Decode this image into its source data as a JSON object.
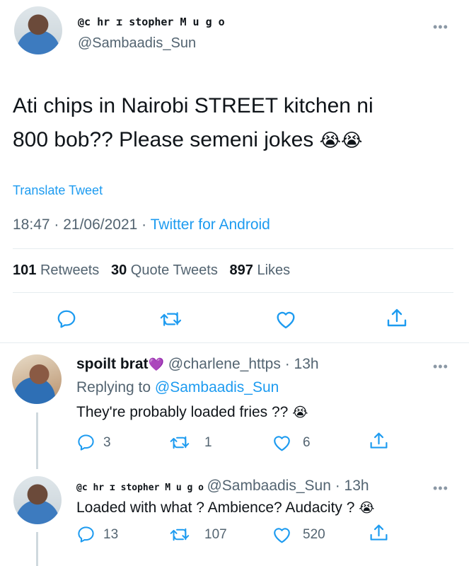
{
  "main_tweet": {
    "display_name": "@c hr ɪ stopher  M u g o",
    "handle": "@Sambaadis_Sun",
    "text_line1": "Ati chips in Nairobi STREET kitchen ni",
    "text_line2": "800 bob?? Please semeni jokes",
    "emoji": "😭😭",
    "translate": "Translate Tweet",
    "timestamp": "18:47 · 21/06/2021 · ",
    "source": "Twitter for Android",
    "retweets_count": "101",
    "retweets_label": "Retweets",
    "quotes_count": "30",
    "quotes_label": "Quote Tweets",
    "likes_count": "897",
    "likes_label": "Likes",
    "more": "•••"
  },
  "reply1": {
    "display_name": "spoilt brat",
    "emoji_heart": "💜",
    "handle_time": "@charlene_https · 13h",
    "replying_prefix": "Replying to ",
    "replying_to": "@Sambaadis_Sun",
    "text": "They're probably loaded fries ??",
    "emoji": "😭",
    "reply_count": "3",
    "retweet_count": "1",
    "like_count": "6",
    "more": "•••"
  },
  "reply2": {
    "display_name": "@c hr ɪ stopher  M u g o",
    "handle_time": "@Sambaadis_Sun · 13h",
    "text": "Loaded with what ? Ambience? Audacity ?",
    "emoji": "😭",
    "reply_count": "13",
    "retweet_count": "107",
    "like_count": "520",
    "more": "•••"
  },
  "icons": {
    "reply": "reply-icon",
    "retweet": "retweet-icon",
    "like": "heart-icon",
    "share": "share-icon"
  },
  "colors": {
    "accent": "#1d9bf0",
    "secondary": "#536471",
    "divider": "#e6ecf0"
  }
}
